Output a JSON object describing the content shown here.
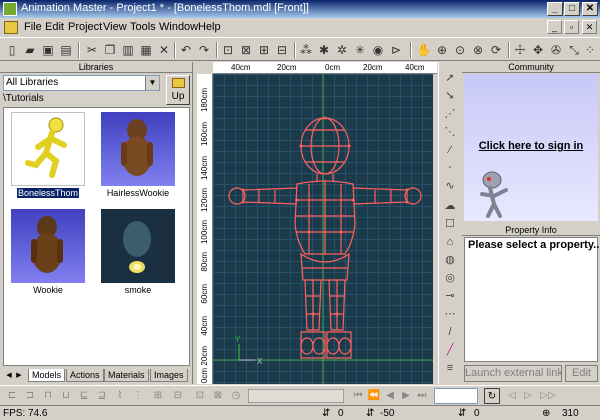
{
  "window": {
    "title": "Animation Master - Project1 * - [BonelessThom.mdl [Front]]",
    "controls": [
      "_",
      "□",
      "✕"
    ]
  },
  "menu": {
    "items": [
      "File",
      "Edit",
      "Project",
      "View",
      "Tools",
      "Window",
      "Help"
    ],
    "mdi_controls": [
      "_",
      "▫",
      "✕"
    ]
  },
  "libraries": {
    "header": "Libraries",
    "dropdown_value": "All Libraries",
    "up_label": "Up",
    "path": "\\Tutorials",
    "items": [
      {
        "label": "BonelessThom",
        "selected": true
      },
      {
        "label": "HairlessWookie",
        "selected": false
      },
      {
        "label": "Wookie",
        "selected": false
      },
      {
        "label": "smoke",
        "selected": false
      }
    ],
    "tabs": [
      "Models",
      "Actions",
      "Materials",
      "Images"
    ]
  },
  "viewport": {
    "ruler_top": [
      "40cm",
      "20cm",
      "0cm",
      "20cm",
      "40cm"
    ],
    "ruler_left": [
      "180cm",
      "160cm",
      "140cm",
      "120cm",
      "100cm",
      "80cm",
      "60cm",
      "40cm",
      "20cm",
      "0cm"
    ],
    "axis_x": "X",
    "axis_y": "Y"
  },
  "community": {
    "header": "Community",
    "sign_in": "Click here to sign in"
  },
  "property": {
    "header": "Property Info",
    "message": "Please select a property...",
    "launch_label": "Launch external link",
    "edit_label": "Edit"
  },
  "status": {
    "fps": "FPS: 74.6",
    "x": "0",
    "y": "-50",
    "z": "0",
    "zoom": "310"
  },
  "colors": {
    "wire": "#ff5050",
    "grid_bg": "#1b3a4a",
    "selection": "#0a246a"
  }
}
